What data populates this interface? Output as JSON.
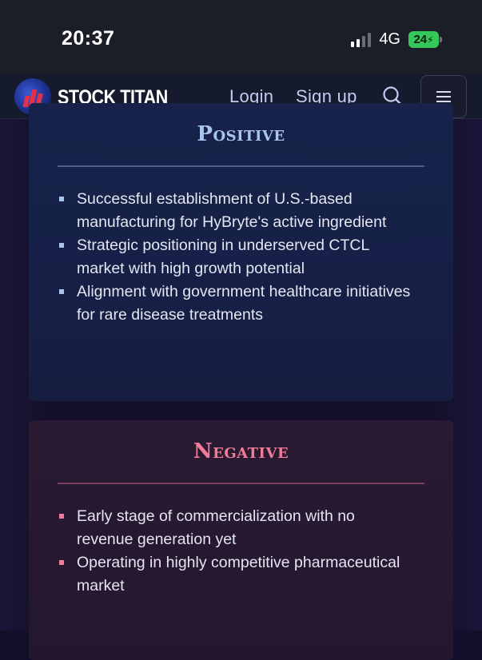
{
  "status_bar": {
    "time": "20:37",
    "network": "4G",
    "battery": "24"
  },
  "navbar": {
    "brand": "STOCK TITAN",
    "login_label": "Login",
    "signup_label": "Sign up",
    "search_icon": "search-icon",
    "menu_icon": "hamburger-menu-icon"
  },
  "positive": {
    "title": "Positive",
    "accent_color": "#a9c5ee",
    "items": [
      "Successful establishment of U.S.-based manufacturing for HyBryte's active ingredient",
      "Strategic positioning in underserved CTCL market with high growth potential",
      "Alignment with government healthcare initiatives for rare disease treatments"
    ]
  },
  "negative": {
    "title": "Negative",
    "accent_color": "#f07c99",
    "items": [
      "Early stage of commercialization with no revenue generation yet",
      "Operating in highly competitive pharmaceutical market"
    ]
  }
}
